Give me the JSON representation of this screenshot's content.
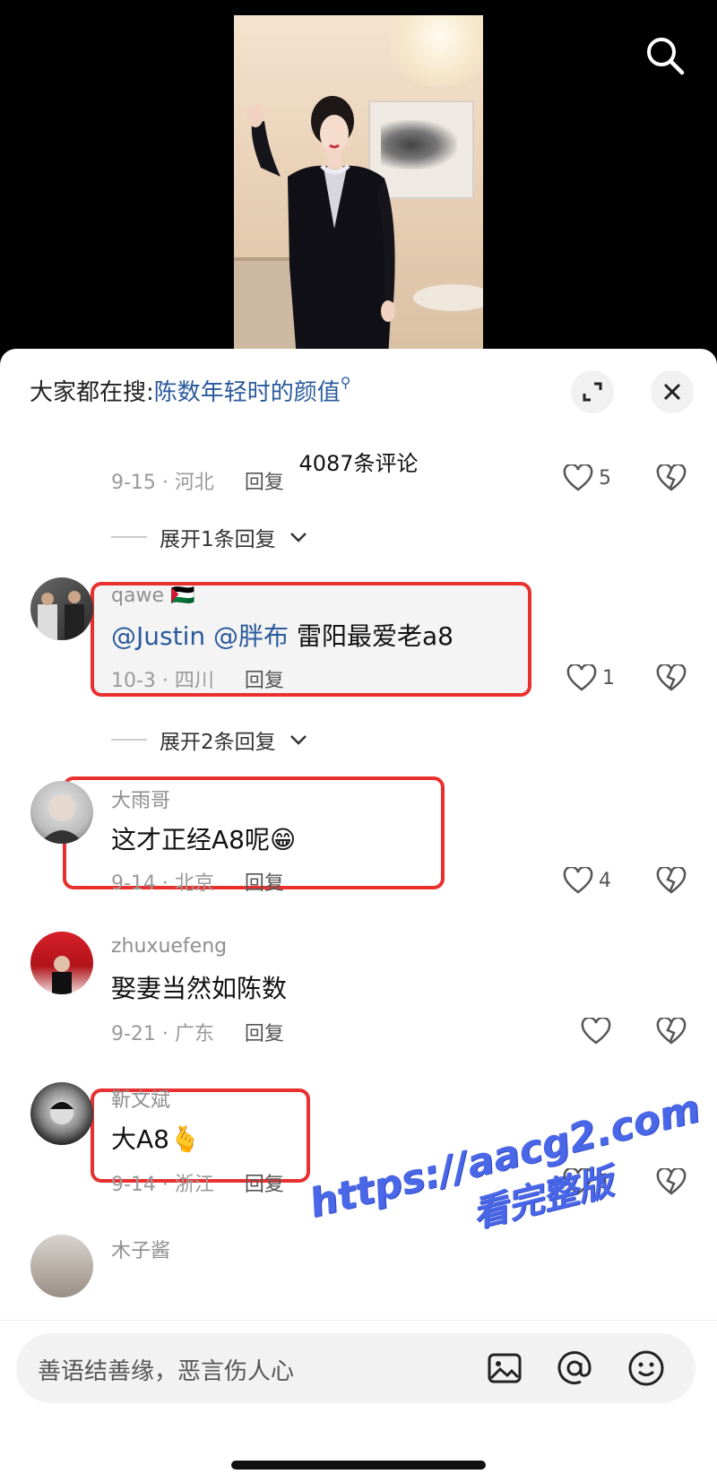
{
  "sheet": {
    "search_prefix": "大家都在搜:",
    "search_keyword": "陈数年轻时的颜值",
    "comment_count": "4087条评论"
  },
  "partial_top": {
    "meta": "9-15 · 河北",
    "reply": "回复",
    "likes": "5"
  },
  "expand_1": "展开1条回复",
  "expand_2": "展开2条回复",
  "comments": [
    {
      "user": "qawe 🇵🇸",
      "mention1": "@Justin",
      "mention2": "@胖布",
      "text": "雷阳最爱老a8",
      "meta": "10-3 · 四川",
      "reply": "回复",
      "likes": "1"
    },
    {
      "user": "大雨哥",
      "text": "这才正经A8呢😁",
      "meta": "9-14 · 北京",
      "reply": "回复",
      "likes": "4"
    },
    {
      "user": "zhuxuefeng",
      "text": "娶妻当然如陈数",
      "meta": "9-21 · 广东",
      "reply": "回复",
      "likes": ""
    },
    {
      "user": "靳文斌",
      "text": "大A8🫰",
      "meta": "9-14 · 浙江",
      "reply": "回复",
      "likes": "1"
    },
    {
      "user": "木子酱"
    }
  ],
  "watermark": {
    "line1": "https://aacg2.com",
    "line2": "看完整版"
  },
  "input": {
    "placeholder": "善语结善缘，恶言伤人心"
  },
  "colors": {
    "accent_link": "#2a5a9c",
    "highlight_red": "#e8312f",
    "watermark_blue": "#4a67e8"
  },
  "icons": [
    "search-icon",
    "expand-icon",
    "close-icon",
    "heart-icon",
    "broken-heart-icon",
    "chevron-down-icon",
    "image-icon",
    "at-icon",
    "emoji-icon"
  ]
}
